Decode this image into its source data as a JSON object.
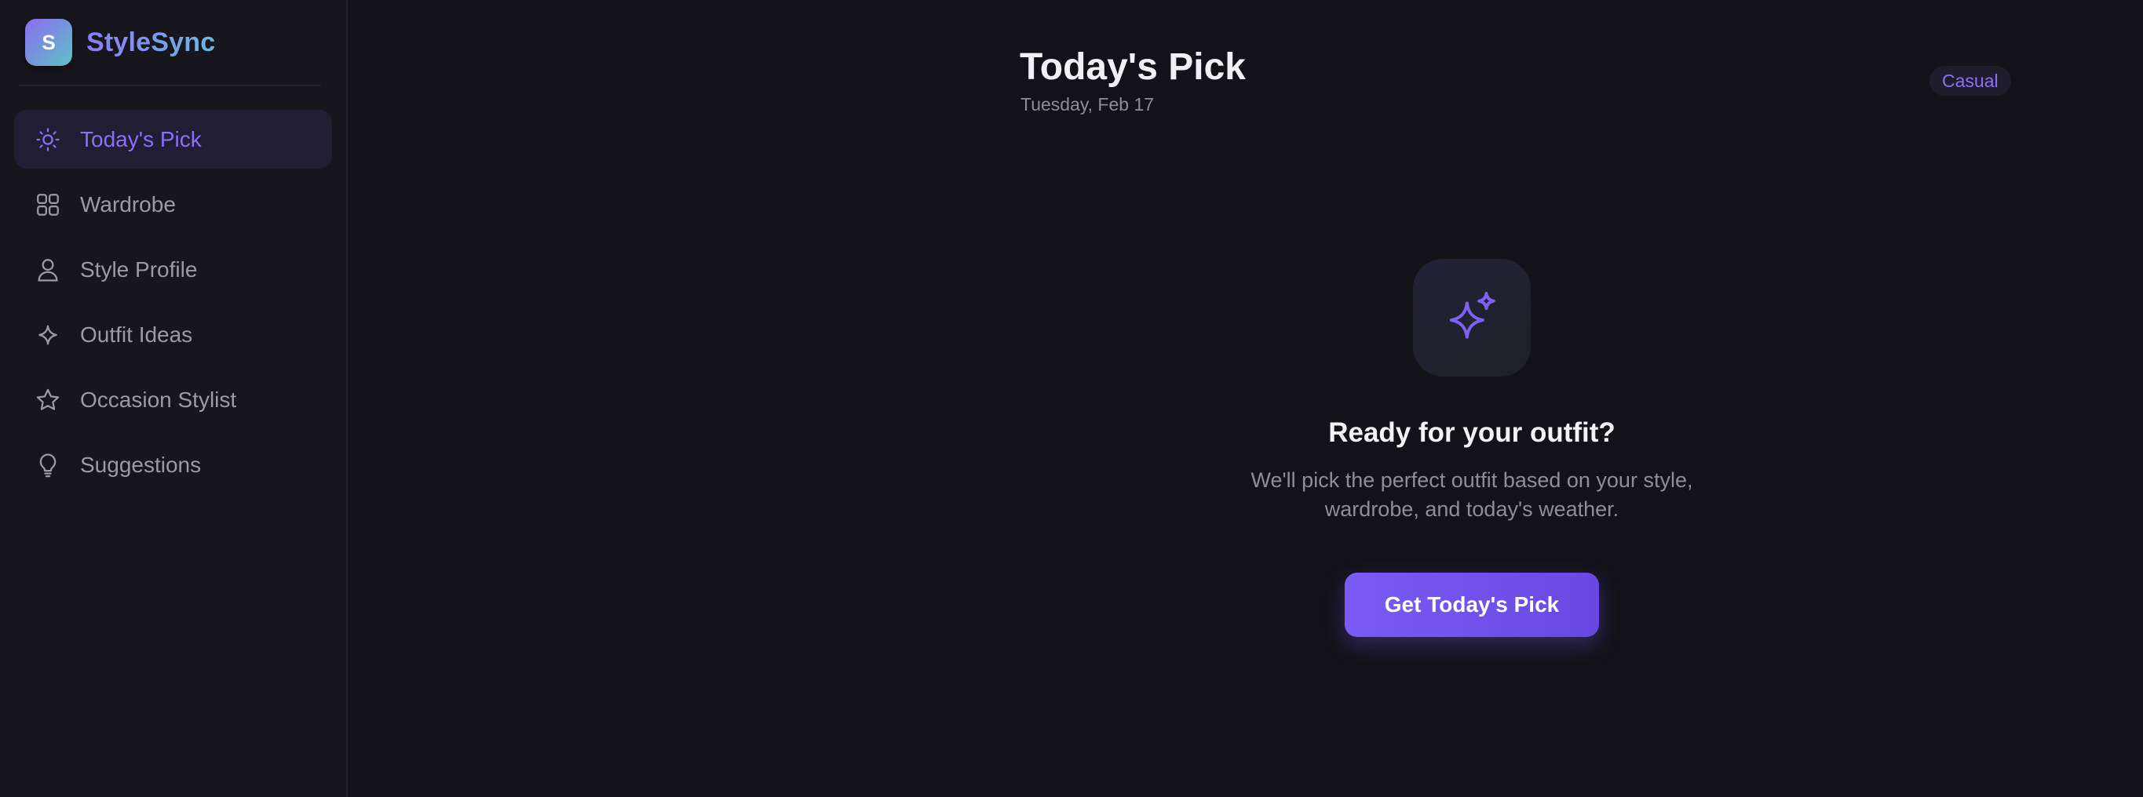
{
  "app": {
    "logo_letter": "S",
    "name": "StyleSync"
  },
  "sidebar": {
    "items": [
      {
        "label": "Today's Pick",
        "icon": "sun-icon",
        "active": true
      },
      {
        "label": "Wardrobe",
        "icon": "grid-icon",
        "active": false
      },
      {
        "label": "Style Profile",
        "icon": "user-icon",
        "active": false
      },
      {
        "label": "Outfit Ideas",
        "icon": "sparkle-icon",
        "active": false
      },
      {
        "label": "Occasion Stylist",
        "icon": "star-icon",
        "active": false
      },
      {
        "label": "Suggestions",
        "icon": "lightbulb-icon",
        "active": false
      }
    ]
  },
  "header": {
    "title": "Today's Pick",
    "date": "Tuesday, Feb 17",
    "badge": "Casual"
  },
  "empty_state": {
    "icon": "sparkles-icon",
    "title": "Ready for your outfit?",
    "description": "We'll pick the perfect outfit based on your style, wardrobe, and today's weather.",
    "button_label": "Get Today's Pick"
  },
  "colors": {
    "accent": "#7a5cf5",
    "background": "#131219",
    "sidebar": "#16161c",
    "active_item_bg": "#211d33",
    "muted_text": "#9a9aa8"
  }
}
